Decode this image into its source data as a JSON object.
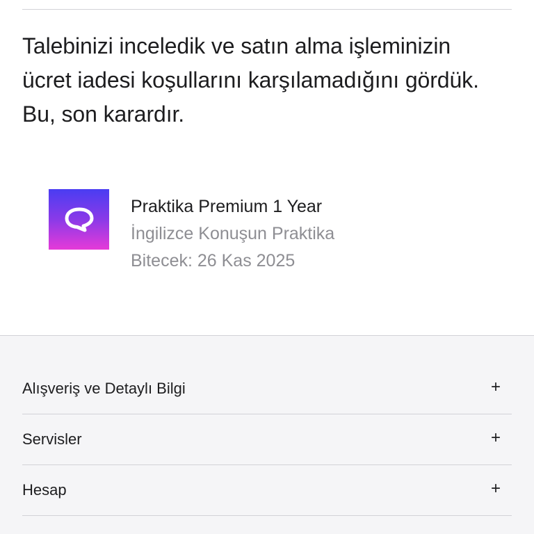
{
  "message": {
    "lines": [
      "Talebinizi inceledik ve satın alma işleminizin",
      "ücret iadesi koşullarını karşılamadığını gördük.",
      "Bu, son karardır."
    ]
  },
  "product": {
    "icon": "chat-bubble-icon",
    "title": "Praktika Premium 1 Year",
    "app_name": "İngilizce Konuşun Praktika",
    "expiry": "Bitecek: 26 Kas 2025",
    "icon_gradient": [
      "#4a3df2",
      "#8a3ae8",
      "#e63ad8"
    ]
  },
  "footer": {
    "items": [
      {
        "label": "Alışveriş ve Detaylı Bilgi",
        "action": "+"
      },
      {
        "label": "Servisler",
        "action": "+"
      },
      {
        "label": "Hesap",
        "action": "+"
      }
    ]
  },
  "colors": {
    "text": "#1d1d1f",
    "secondary_text": "#8e8e93",
    "divider": "#d2d2d7",
    "footer_bg": "#f5f5f7"
  }
}
